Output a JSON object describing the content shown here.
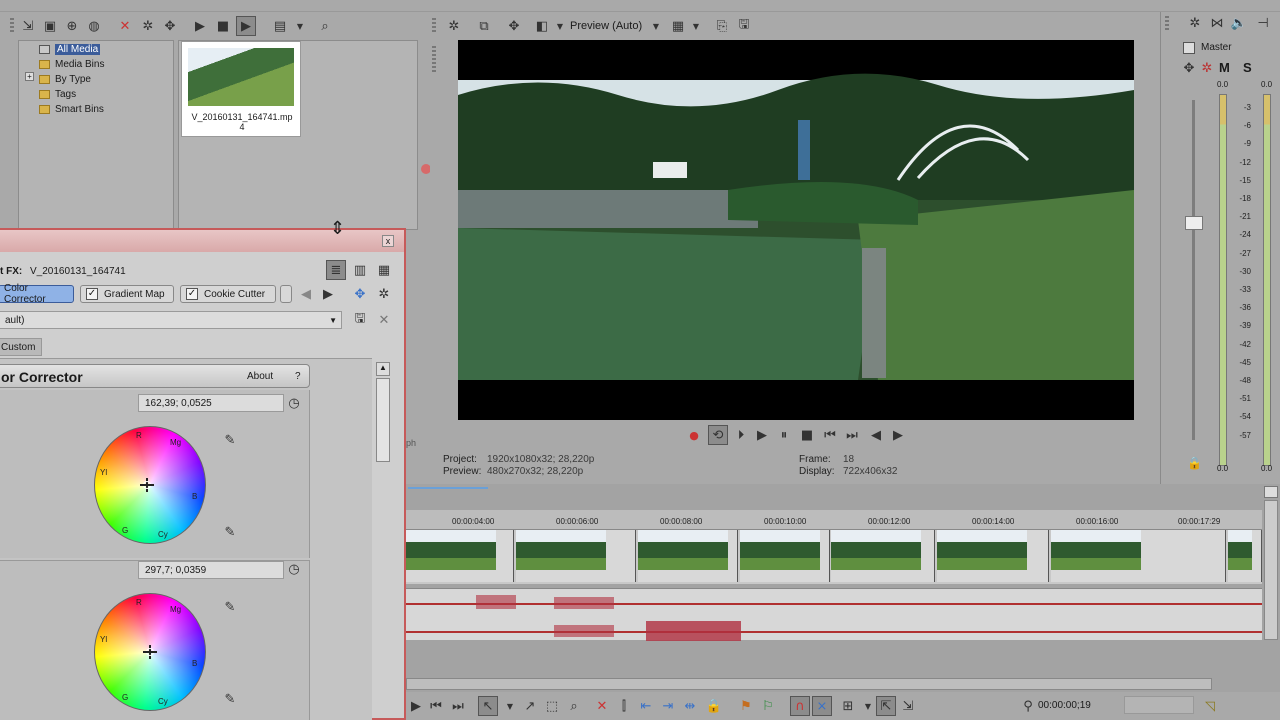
{
  "explorer": {
    "tree": [
      {
        "label": "All Media",
        "selected": true
      },
      {
        "label": "Media Bins",
        "selected": false
      },
      {
        "label": "By Type",
        "selected": false
      },
      {
        "label": "Tags",
        "selected": false
      },
      {
        "label": "Smart Bins",
        "selected": false
      }
    ],
    "expand_glyph": "+",
    "media_file": {
      "name_line1": "V_20160131_164741.mp",
      "name_line2": "4"
    }
  },
  "preview_toolbar": {
    "mode_label": "Preview (Auto)"
  },
  "fx": {
    "close_glyph": "x",
    "title_prefix": "t FX:",
    "title_value": "V_20160131_164741",
    "chain": [
      "Color Corrector",
      "Gradient Map",
      "Cookie Cutter"
    ],
    "preset": "ault)",
    "tab_custom": "Custom",
    "plugin_title": "or Corrector",
    "about": "About",
    "help": "?",
    "wheel1_value": "162,39; 0,0525",
    "wheel2_value": "297,7; 0,0359",
    "wheel_labels": {
      "r": "R",
      "mg": "Mg",
      "b": "B",
      "cy": "Cy",
      "g": "G",
      "yl": "Yl"
    },
    "behind_label": "ph"
  },
  "video_info": {
    "project_label": "Project:",
    "project_value": "1920x1080x32; 28,220p",
    "preview_label": "Preview:",
    "preview_value": "480x270x32; 28,220p",
    "frame_label": "Frame:",
    "frame_value": "18",
    "display_label": "Display:",
    "display_value": "722x406x32"
  },
  "master": {
    "label": "Master",
    "m": "M",
    "s": "S",
    "left_peak": "0.0",
    "right_peak": "0.0",
    "db_ticks": [
      "3",
      "6",
      "9",
      "12",
      "15",
      "18",
      "21",
      "24",
      "27",
      "30",
      "33",
      "36",
      "39",
      "42",
      "45",
      "48",
      "51",
      "54",
      "57"
    ],
    "bottom_left": "0.0",
    "bottom_right": "0.0"
  },
  "timeline": {
    "ruler": [
      "00:00:04:00",
      "00:00:06:00",
      "00:00:08:00",
      "00:00:10:00",
      "00:00:12:00",
      "00:00:14:00",
      "00:00:16:00",
      "00:00:17:29"
    ],
    "timecode": "00:00:00;19"
  },
  "colors": {
    "fx_border": "#c65a5a",
    "selection": "#3b5c9a",
    "waveform": "#b03030"
  }
}
